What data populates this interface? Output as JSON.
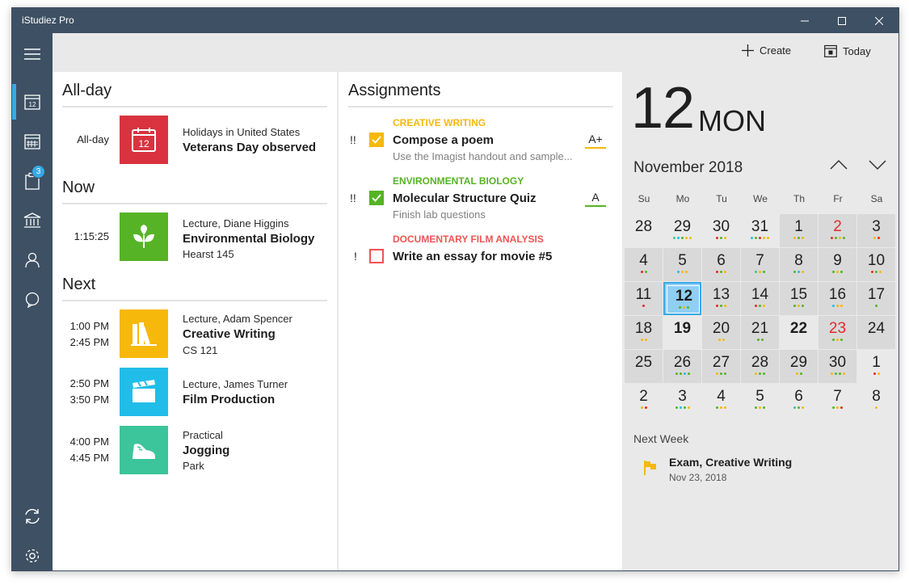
{
  "window": {
    "title": "iStudiez Pro"
  },
  "toolbar": {
    "create_label": "Create",
    "today_label": "Today"
  },
  "sidebar": {
    "assignments_badge": "3"
  },
  "schedule": {
    "allday": {
      "heading": "All-day",
      "event": {
        "time": "All-day",
        "day_number": "12",
        "kind": "Holidays in United States",
        "name": "Veterans Day observed",
        "color": "#d9333f"
      }
    },
    "now": {
      "heading": "Now",
      "event": {
        "time": "1:15:25",
        "kind": "Lecture, Diane Higgins",
        "name": "Environmental Biology",
        "location": "Hearst 145",
        "color": "#55b325"
      }
    },
    "next": {
      "heading": "Next",
      "events": [
        {
          "start": "1:00 PM",
          "end": "2:45 PM",
          "kind": "Lecture, Adam Spencer",
          "name": "Creative Writing",
          "location": "CS 121",
          "color": "#f6b80a"
        },
        {
          "start": "2:50 PM",
          "end": "3:50 PM",
          "kind": "Lecture, James Turner",
          "name": "Film Production",
          "location": "",
          "color": "#20bde9"
        },
        {
          "start": "4:00 PM",
          "end": "4:45 PM",
          "kind": "Practical",
          "name": "Jogging",
          "location": "Park",
          "color": "#3cc49a"
        }
      ]
    }
  },
  "assignments": {
    "heading": "Assignments",
    "items": [
      {
        "priority": "!!",
        "course": "CREATIVE WRITING",
        "course_color": "#f6b80a",
        "title": "Compose a poem",
        "description": "Use the Imagist handout and sample...",
        "grade": "A+",
        "checked": true
      },
      {
        "priority": "!!",
        "course": "ENVIRONMENTAL BIOLOGY",
        "course_color": "#55b325",
        "title": "Molecular Structure Quiz",
        "description": "Finish lab questions",
        "grade": "A",
        "checked": true
      },
      {
        "priority": "!",
        "course": "DOCUMENTARY FILM ANALYSIS",
        "course_color": "#ef5454",
        "title": "Write an essay for movie #5",
        "description": "",
        "grade": "",
        "checked": false
      }
    ]
  },
  "calendar": {
    "big_day": "12",
    "big_weekday": "MON",
    "month_label": "November 2018",
    "weekdays": [
      "Su",
      "Mo",
      "Tu",
      "We",
      "Th",
      "Fr",
      "Sa"
    ],
    "dot_colors": {
      "y": "#f6b80a",
      "g": "#55b325",
      "b": "#20bde9",
      "r": "#e32a2a",
      "t": "#3cc49a"
    },
    "weeks": [
      [
        {
          "d": "28",
          "dots": ""
        },
        {
          "d": "29",
          "dots": "tbgyy"
        },
        {
          "d": "30",
          "dots": "rgy"
        },
        {
          "d": "31",
          "dots": "bgryy"
        },
        {
          "d": "1",
          "dots": "ygy",
          "shade": true
        },
        {
          "d": "2",
          "dots": "rgyg",
          "shade": true,
          "red": true
        },
        {
          "d": "3",
          "dots": "yr",
          "shade": true
        }
      ],
      [
        {
          "d": "4",
          "dots": "rg",
          "shade": true
        },
        {
          "d": "5",
          "dots": "byy",
          "shade": true
        },
        {
          "d": "6",
          "dots": "rgy",
          "shade": true
        },
        {
          "d": "7",
          "dots": "tyg",
          "shade": true
        },
        {
          "d": "8",
          "dots": "gby",
          "shade": true
        },
        {
          "d": "9",
          "dots": "gyg",
          "shade": true
        },
        {
          "d": "10",
          "dots": "rgy",
          "shade": true
        }
      ],
      [
        {
          "d": "11",
          "dots": "r",
          "shade": true
        },
        {
          "d": "12",
          "dots": "gyg",
          "today": true,
          "bold": true
        },
        {
          "d": "13",
          "dots": "rgy",
          "shade": true
        },
        {
          "d": "14",
          "dots": "rgy",
          "shade": true
        },
        {
          "d": "15",
          "dots": "gyg",
          "shade": true
        },
        {
          "d": "16",
          "dots": "byy",
          "shade": true
        },
        {
          "d": "17",
          "dots": "g",
          "shade": true
        }
      ],
      [
        {
          "d": "18",
          "dots": "yy",
          "shade": true
        },
        {
          "d": "19",
          "dots": "",
          "bold": true
        },
        {
          "d": "20",
          "dots": "yy",
          "shade": true
        },
        {
          "d": "21",
          "dots": "gg",
          "shade": true
        },
        {
          "d": "22",
          "dots": "",
          "bold": true
        },
        {
          "d": "23",
          "dots": "gyg",
          "shade": true,
          "red": true
        },
        {
          "d": "24",
          "dots": "",
          "shade": true
        }
      ],
      [
        {
          "d": "25",
          "dots": "",
          "shade": true
        },
        {
          "d": "26",
          "dots": "ggbg",
          "shade": true
        },
        {
          "d": "27",
          "dots": "ygg",
          "shade": true
        },
        {
          "d": "28",
          "dots": "ygg",
          "shade": true
        },
        {
          "d": "29",
          "dots": "yg",
          "shade": true
        },
        {
          "d": "30",
          "dots": "yggy",
          "shade": true
        },
        {
          "d": "1",
          "dots": "ry"
        }
      ],
      [
        {
          "d": "2",
          "dots": "yr"
        },
        {
          "d": "3",
          "dots": "gbgy"
        },
        {
          "d": "4",
          "dots": "gyy"
        },
        {
          "d": "5",
          "dots": "gyg"
        },
        {
          "d": "6",
          "dots": "tgy"
        },
        {
          "d": "7",
          "dots": "gyr"
        },
        {
          "d": "8",
          "dots": "y"
        }
      ]
    ]
  },
  "next_week": {
    "label": "Next Week",
    "title": "Exam, Creative Writing",
    "date": "Nov 23, 2018",
    "flag_color": "#f6b80a"
  }
}
